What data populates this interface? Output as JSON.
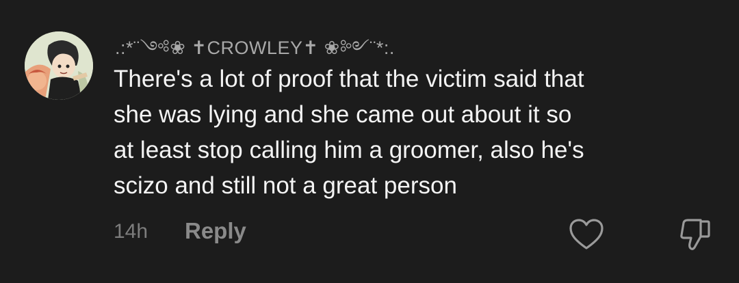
{
  "comment": {
    "username": ".:*¨༺❀ ✝CROWLEY✝ ❀༻¨*:.",
    "text_lines": [
      "There's a lot of proof that the victim said that",
      "she was lying and she came out about it so",
      "at least stop calling him a groomer, also he's",
      "scizo and still not a great person"
    ],
    "timestamp": "14h",
    "reply_label": "Reply",
    "icons": {
      "like": "heart-icon",
      "dislike": "thumbs-down-icon"
    }
  },
  "colors": {
    "background": "#1c1c1c",
    "text": "#f4f4f4",
    "muted": "#8a8a8a"
  }
}
